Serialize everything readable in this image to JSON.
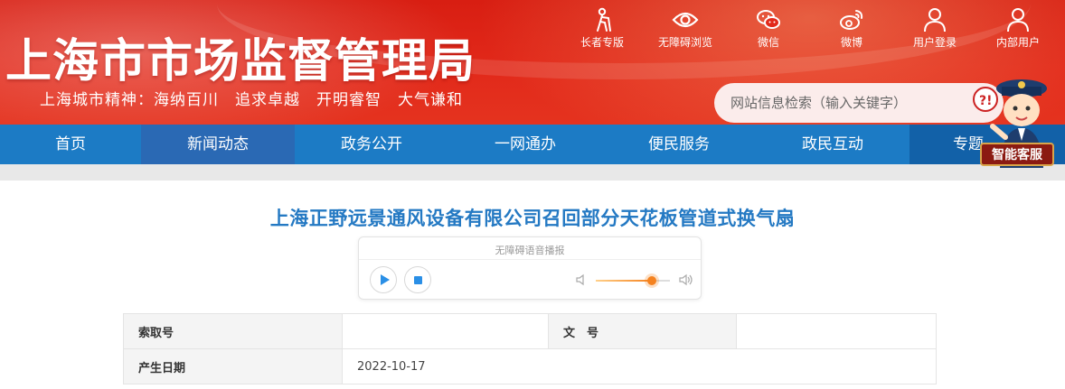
{
  "header": {
    "site_title": "上海市市场监督管理局",
    "city_spirit": "上海城市精神：海纳百川　追求卓越　开明睿智　大气谦和",
    "top_links": [
      {
        "label": "长者专版",
        "icon": "elderly-icon"
      },
      {
        "label": "无障碍浏览",
        "icon": "eye-icon"
      },
      {
        "label": "微信",
        "icon": "wechat-icon"
      },
      {
        "label": "微博",
        "icon": "weibo-icon"
      },
      {
        "label": "用户登录",
        "icon": "user-icon"
      },
      {
        "label": "内部用户",
        "icon": "internal-user-icon"
      }
    ],
    "search_placeholder": "网站信息检索（输入关键字）"
  },
  "smart_service_label": "智能客服",
  "nav": {
    "items": [
      "首页",
      "新闻动态",
      "政务公开",
      "一网通办",
      "便民服务",
      "政民互动",
      "专题"
    ]
  },
  "article": {
    "title": "上海正野远景通风设备有限公司召回部分天花板管道式换气扇",
    "player_label": "无障碍语音播报",
    "volume_level": 0.75
  },
  "info_table": {
    "index_label": "索取号",
    "index_value": "",
    "doc_no_label": "文　号",
    "doc_no_value": "",
    "date_label": "产生日期",
    "date_value": "2022-10-17"
  },
  "colors": {
    "header_red": "#d81e12",
    "nav_blue": "#1c7bc5",
    "nav_active": "#2a69b4",
    "title_blue": "#2479c3",
    "accent_orange": "#f5821f"
  }
}
